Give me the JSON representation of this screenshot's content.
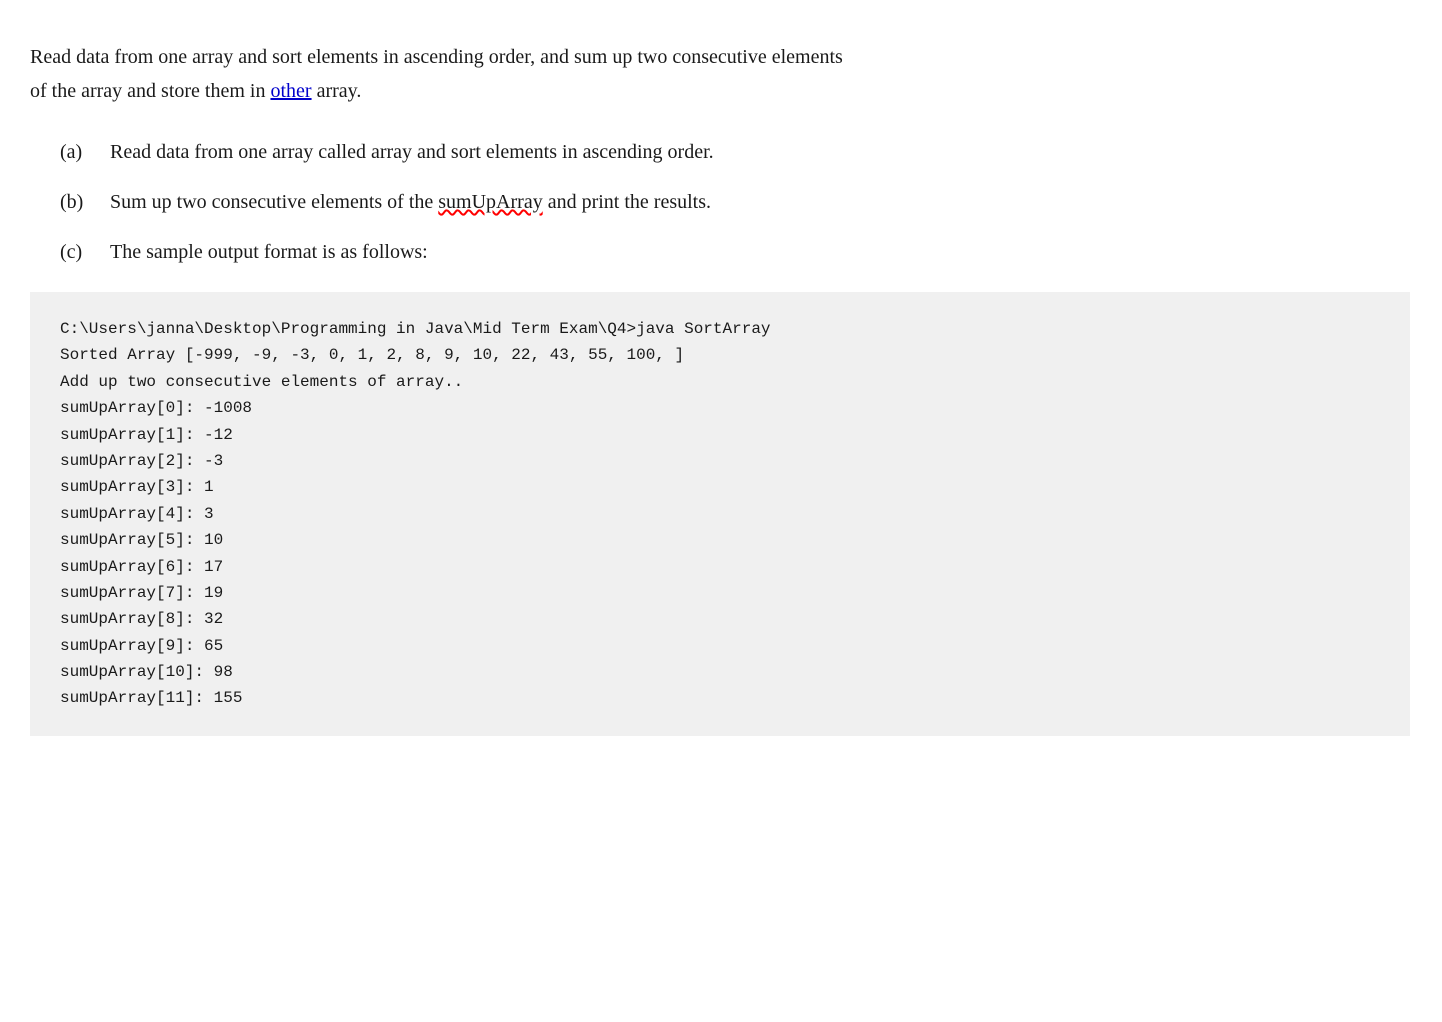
{
  "intro": {
    "text1": "Read data from one array and sort elements in ascending order, and sum up two consecutive elements",
    "text2": "of the array and store them in ",
    "underline_word": "other",
    "text3": " array."
  },
  "list": {
    "items": [
      {
        "label": "(a)",
        "text": "Read data from one array called array and sort elements in ascending order."
      },
      {
        "label": "(b)",
        "text_before": "Sum up two consecutive elements of the ",
        "underline_word": "sumUpArray",
        "text_after": " and print the results."
      },
      {
        "label": "(c)",
        "text": "The sample output format is as follows:"
      }
    ]
  },
  "code": {
    "content": "C:\\Users\\janna\\Desktop\\Programming in Java\\Mid Term Exam\\Q4>java SortArray\nSorted Array [-999, -9, -3, 0, 1, 2, 8, 9, 10, 22, 43, 55, 100, ]\nAdd up two consecutive elements of array..\nsumUpArray[0]: -1008\nsumUpArray[1]: -12\nsumUpArray[2]: -3\nsumUpArray[3]: 1\nsumUpArray[4]: 3\nsumUpArray[5]: 10\nsumUpArray[6]: 17\nsumUpArray[7]: 19\nsumUpArray[8]: 32\nsumUpArray[9]: 65\nsumUpArray[10]: 98\nsumUpArray[11]: 155"
  }
}
